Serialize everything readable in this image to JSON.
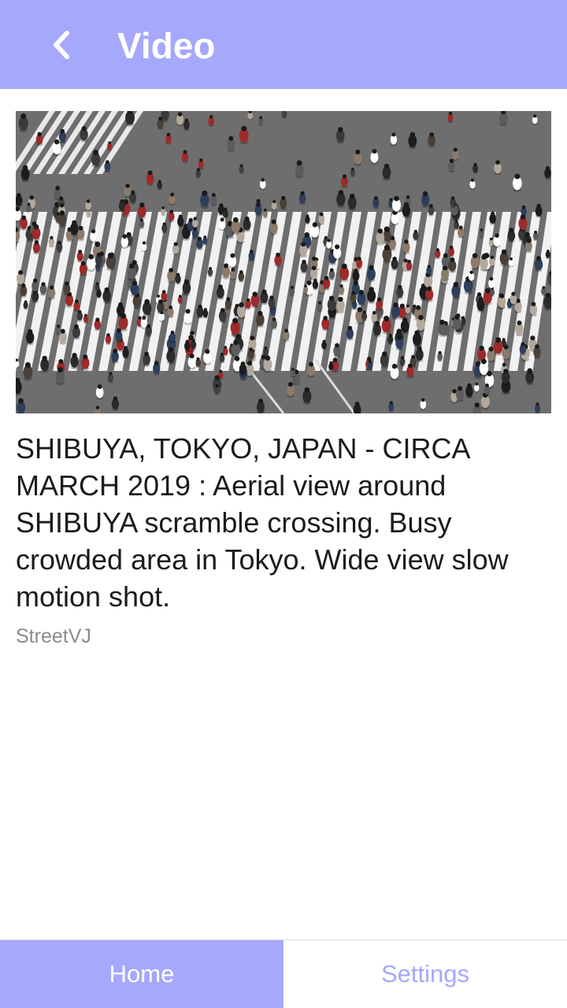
{
  "header": {
    "title": "Video",
    "back_icon": "chevron-left-icon",
    "background_color": "#a5a8fb"
  },
  "video": {
    "title": "SHIBUYA, TOKYO, JAPAN - CIRCA MARCH 2019 : Aerial view around SHIBUYA scramble crossing. Busy crowded area in Tokyo. Wide view slow motion shot.",
    "author": "StreetVJ"
  },
  "bottom_nav": {
    "tabs": [
      {
        "label": "Home",
        "active": true
      },
      {
        "label": "Settings",
        "active": false
      }
    ],
    "accent_color": "#a5a8fb"
  }
}
